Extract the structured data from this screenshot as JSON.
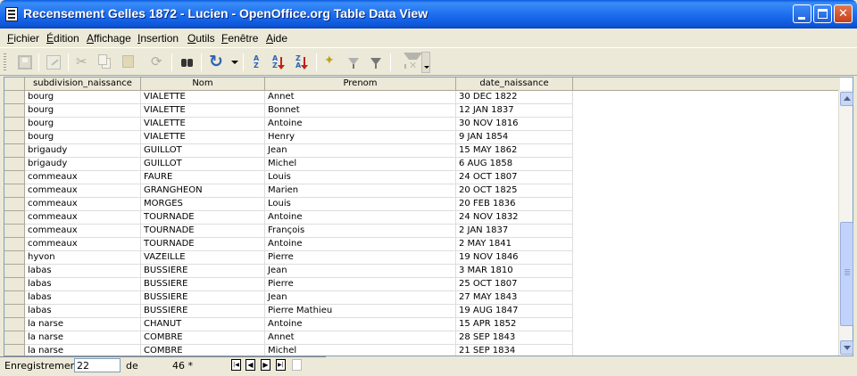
{
  "window": {
    "title": "Recensement Gelles 1872 - Lucien - OpenOffice.org Table Data View"
  },
  "menu": [
    {
      "label": "Fichier"
    },
    {
      "label": "Édition"
    },
    {
      "label": "Affichage"
    },
    {
      "label": "Insertion"
    },
    {
      "label": "Outils"
    },
    {
      "label": "Fenêtre"
    },
    {
      "label": "Aide"
    }
  ],
  "toolbar": {
    "sort_asc_label": "A",
    "sort_desc_label": "Z"
  },
  "table": {
    "columns": [
      "subdivision_naissance",
      "Nom",
      "Prenom",
      "date_naissance"
    ],
    "rows": [
      [
        "bourg",
        "VIALETTE",
        "Annet",
        "30 DEC 1822"
      ],
      [
        "bourg",
        "VIALETTE",
        "Bonnet",
        "12 JAN 1837"
      ],
      [
        "bourg",
        "VIALETTE",
        "Antoine",
        "30 NOV 1816"
      ],
      [
        "bourg",
        "VIALETTE",
        "Henry",
        "9 JAN 1854"
      ],
      [
        "brigaudy",
        "GUILLOT",
        "Jean",
        "15 MAY 1862"
      ],
      [
        "brigaudy",
        "GUILLOT",
        "Michel",
        "6 AUG 1858"
      ],
      [
        "commeaux",
        "FAURE",
        "Louis",
        "24 OCT 1807"
      ],
      [
        "commeaux",
        "GRANGHEON",
        "Marien",
        "20 OCT 1825"
      ],
      [
        "commeaux",
        "MORGES",
        "Louis",
        "20 FEB 1836"
      ],
      [
        "commeaux",
        "TOURNADE",
        "Antoine",
        "24 NOV 1832"
      ],
      [
        "commeaux",
        "TOURNADE",
        "François",
        "2 JAN 1837"
      ],
      [
        "commeaux",
        "TOURNADE",
        "Antoine",
        "2 MAY 1841"
      ],
      [
        "hyvon",
        "VAZEILLE",
        "Pierre",
        "19 NOV 1846"
      ],
      [
        "labas",
        "BUSSIERE",
        "Jean",
        "3 MAR 1810"
      ],
      [
        "labas",
        "BUSSIERE",
        "Pierre",
        "25 OCT 1807"
      ],
      [
        "labas",
        "BUSSIERE",
        "Jean",
        "27 MAY 1843"
      ],
      [
        "labas",
        "BUSSIERE",
        "Pierre Mathieu",
        "19 AUG 1847"
      ],
      [
        "la narse",
        "CHANUT",
        "Antoine",
        "15 APR 1852"
      ],
      [
        "la narse",
        "COMBRE",
        "Annet",
        "28 SEP 1843"
      ],
      [
        "la narse",
        "COMBRE",
        "Michel",
        "21 SEP 1834"
      ]
    ]
  },
  "navigation": {
    "record_label": "Enregistrement",
    "record_value": "22",
    "of_label": "de",
    "total": "46 *"
  }
}
